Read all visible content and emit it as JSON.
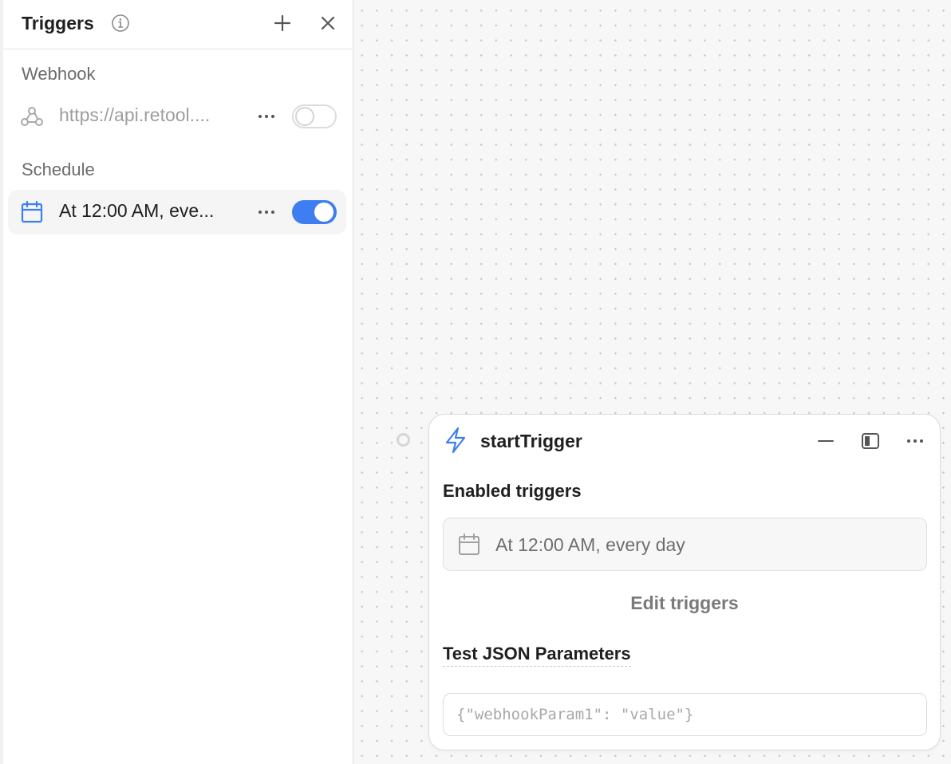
{
  "panel": {
    "title": "Triggers",
    "sections": [
      {
        "label": "Webhook",
        "item": {
          "text": "https://api.retool....",
          "enabled": false,
          "icon": "webhook-icon"
        }
      },
      {
        "label": "Schedule",
        "item": {
          "text": "At 12:00 AM, eve...",
          "enabled": true,
          "icon": "calendar-icon"
        }
      }
    ]
  },
  "block": {
    "title": "startTrigger",
    "icon": "bolt-icon",
    "enabled_label": "Enabled triggers",
    "enabled_value": "At 12:00 AM, every day",
    "edit_button": "Edit triggers",
    "params_label": "Test JSON Parameters",
    "params_placeholder": "{\"webhookParam1\": \"value\"}",
    "params_value": ""
  },
  "colors": {
    "accent": "#3e7ef0",
    "toggle_off_border": "#dcdcdc",
    "muted_text": "#9e9e9e"
  }
}
